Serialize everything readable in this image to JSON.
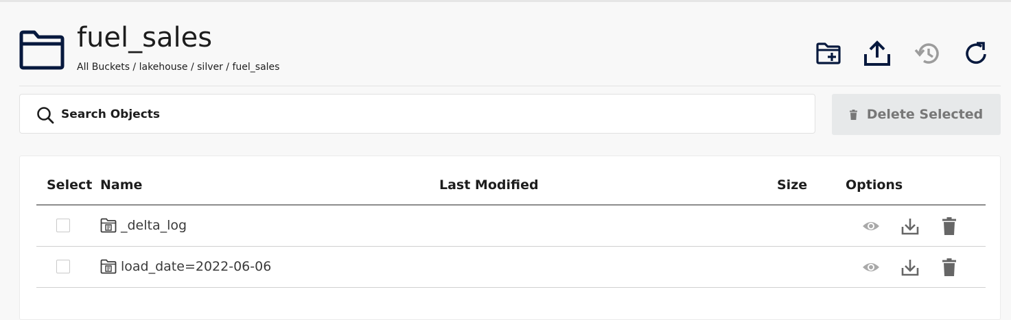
{
  "header": {
    "title": "fuel_sales",
    "breadcrumb": "All Buckets / lakehouse / silver / fuel_sales",
    "icons": [
      "create-folder-icon",
      "upload-icon",
      "rewind-history-icon",
      "refresh-icon"
    ]
  },
  "search": {
    "placeholder": "Search Objects",
    "value": ""
  },
  "actions": {
    "delete_selected_label": "Delete Selected",
    "delete_selected_enabled": false
  },
  "table": {
    "columns": [
      "Select",
      "Name",
      "Last Modified",
      "Size",
      "Options"
    ],
    "rows": [
      {
        "name": "_delta_log",
        "last_modified": "",
        "size": "",
        "selected": false,
        "type_icon": "folder-icon"
      },
      {
        "name": "load_date=2022-06-06",
        "last_modified": "",
        "size": "",
        "selected": false,
        "type_icon": "folder-icon"
      }
    ],
    "option_icons": [
      "preview-icon",
      "download-icon",
      "delete-icon"
    ]
  },
  "colors": {
    "accent": "#07193e",
    "text": "#1d1d1d",
    "muted_icon": "#9c9c9c",
    "disabled_button_bg": "#e7e9ea"
  }
}
